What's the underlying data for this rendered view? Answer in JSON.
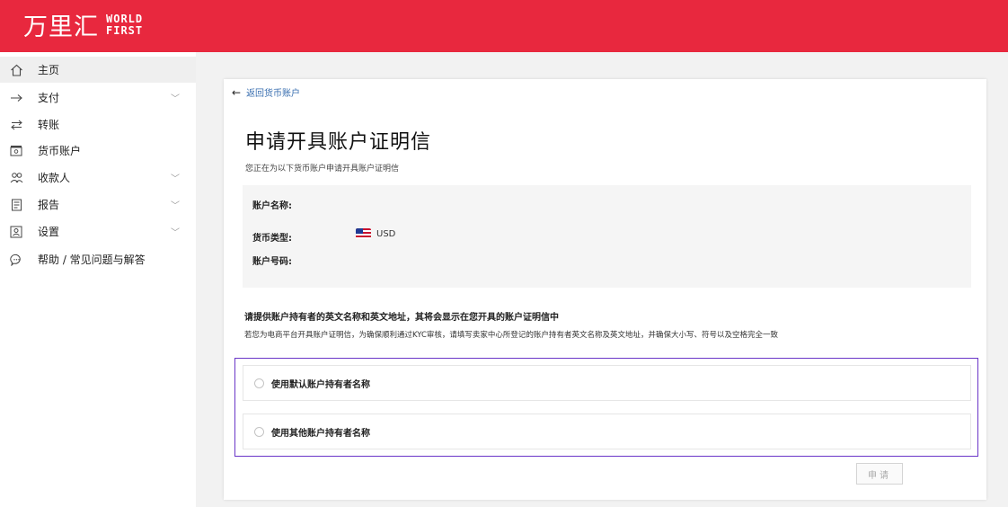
{
  "header": {
    "logo_cn": "万里汇",
    "logo_en_line1": "WORLD",
    "logo_en_line2": "FIRST",
    "brand_color": "#e8283e"
  },
  "sidebar": {
    "items": [
      {
        "label": "主页",
        "icon": "home-icon",
        "expandable": false,
        "active": true
      },
      {
        "label": "支付",
        "icon": "arrow-right-icon",
        "expandable": true,
        "active": false
      },
      {
        "label": "转账",
        "icon": "transfer-icon",
        "expandable": false,
        "active": false
      },
      {
        "label": "货币账户",
        "icon": "wallet-icon",
        "expandable": false,
        "active": false
      },
      {
        "label": "收款人",
        "icon": "people-icon",
        "expandable": true,
        "active": false
      },
      {
        "label": "报告",
        "icon": "report-icon",
        "expandable": true,
        "active": false
      },
      {
        "label": "设置",
        "icon": "settings-icon",
        "expandable": true,
        "active": false
      },
      {
        "label": "帮助 / 常见问题与解答",
        "icon": "help-icon",
        "expandable": false,
        "active": false
      }
    ]
  },
  "main": {
    "back_link": "返回货币账户",
    "title": "申请开具账户证明信",
    "subtitle": "您正在为以下货币账户申请开具账户证明信",
    "account_info": {
      "name_label": "账户名称:",
      "currency_label": "货币类型:",
      "currency_value": "USD",
      "number_label": "账户号码:"
    },
    "holder_section": {
      "title": "请提供账户持有者的英文名称和英文地址，其将会显示在您开具的账户证明信中",
      "note": "若您为电商平台开具账户证明信，为确保顺利通过KYC审核，请填写卖家中心所登记的账户持有者英文名称及英文地址，并确保大小写、符号以及空格完全一致"
    },
    "options": [
      {
        "label": "使用默认账户持有者名称",
        "selected": false
      },
      {
        "label": "使用其他账户持有者名称",
        "selected": false
      }
    ],
    "submit_label": "申请",
    "highlight_color": "#6a35c8"
  }
}
